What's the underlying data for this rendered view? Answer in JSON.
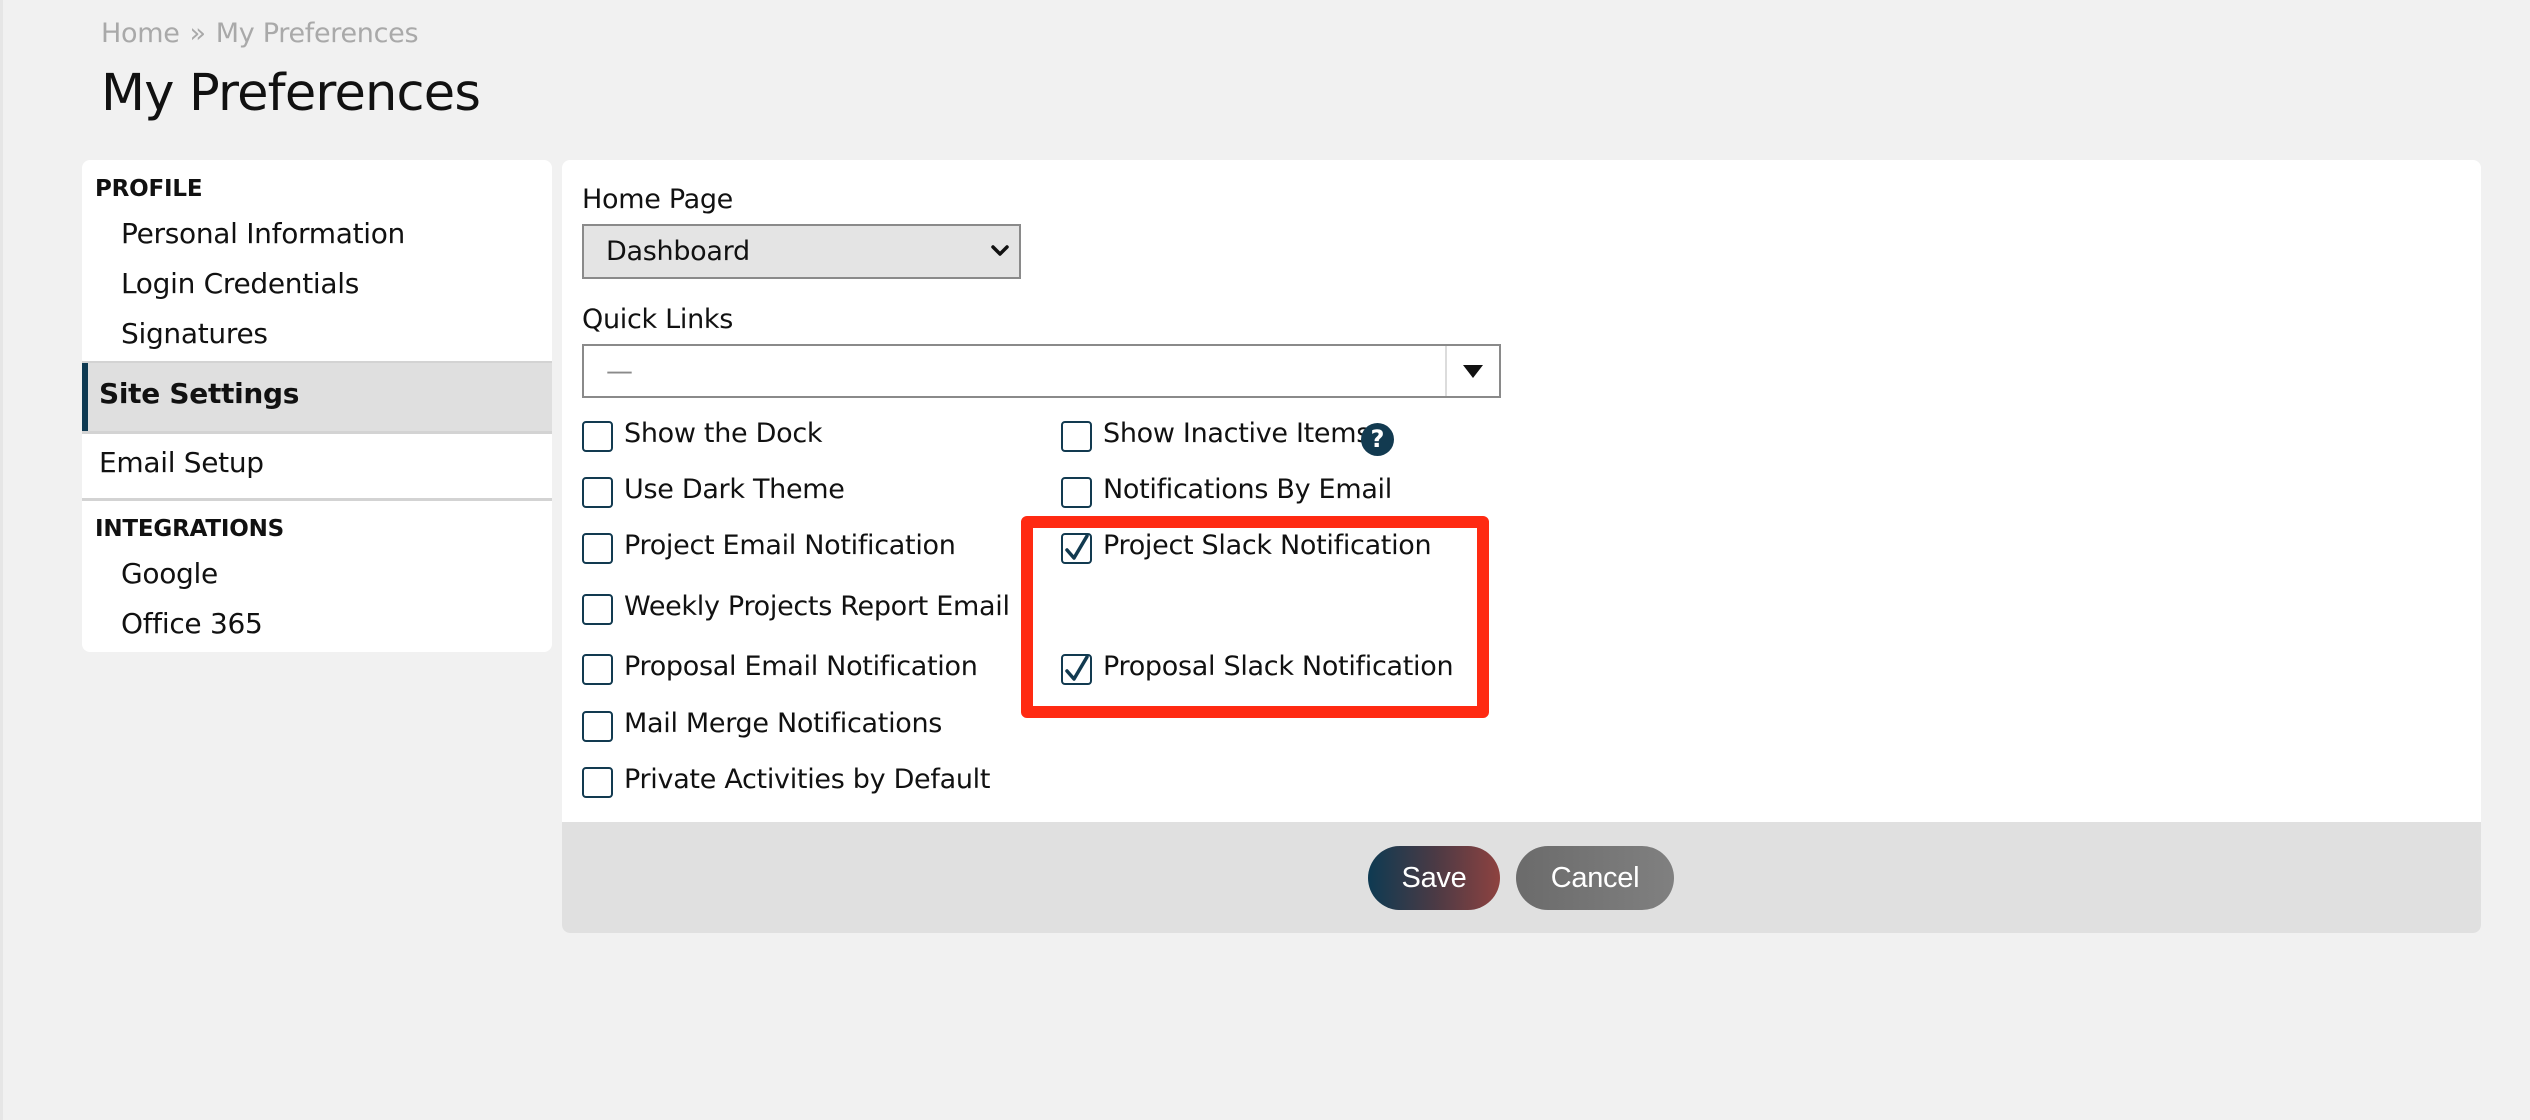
{
  "breadcrumb": {
    "items": [
      "Home",
      "My Preferences"
    ],
    "separator": "»"
  },
  "page_title": "My Preferences",
  "sidebar": {
    "sections": [
      {
        "title": "PROFILE",
        "items": [
          "Personal Information",
          "Login Credentials",
          "Signatures"
        ]
      },
      {
        "title": "INTEGRATIONS",
        "items": [
          "Google",
          "Office 365"
        ]
      }
    ],
    "top_items": [
      {
        "label": "Site Settings",
        "active": true
      },
      {
        "label": "Email Setup",
        "active": false
      }
    ]
  },
  "form": {
    "home_page": {
      "label": "Home Page",
      "value": "Dashboard"
    },
    "quick_links": {
      "label": "Quick Links",
      "value": "—"
    },
    "checkboxes_left": [
      {
        "label": "Show the Dock",
        "checked": false
      },
      {
        "label": "Use Dark Theme",
        "checked": false
      },
      {
        "label": "Project Email Notification",
        "checked": false
      },
      {
        "label": "Weekly Projects Report Email",
        "checked": false
      },
      {
        "label": "Proposal Email Notification",
        "checked": false
      },
      {
        "label": "Mail Merge Notifications",
        "checked": false
      },
      {
        "label": "Private Activities by Default",
        "checked": false
      }
    ],
    "checkboxes_right": [
      {
        "label": "Show Inactive Items",
        "checked": false,
        "help": "?"
      },
      {
        "label": "Notifications By Email",
        "checked": false
      },
      {
        "label": "Project Slack Notification",
        "checked": true
      },
      {
        "label": "Proposal Slack Notification",
        "checked": true
      }
    ]
  },
  "footer": {
    "save_label": "Save",
    "cancel_label": "Cancel"
  },
  "colors": {
    "accent_navy": "#0e3a52",
    "accent_rust": "#8e4240",
    "annotation_red": "#ff2a12",
    "checkbox_border": "#123a50"
  },
  "annotation": {
    "type": "highlight-box",
    "target": "Slack notification checkboxes"
  }
}
